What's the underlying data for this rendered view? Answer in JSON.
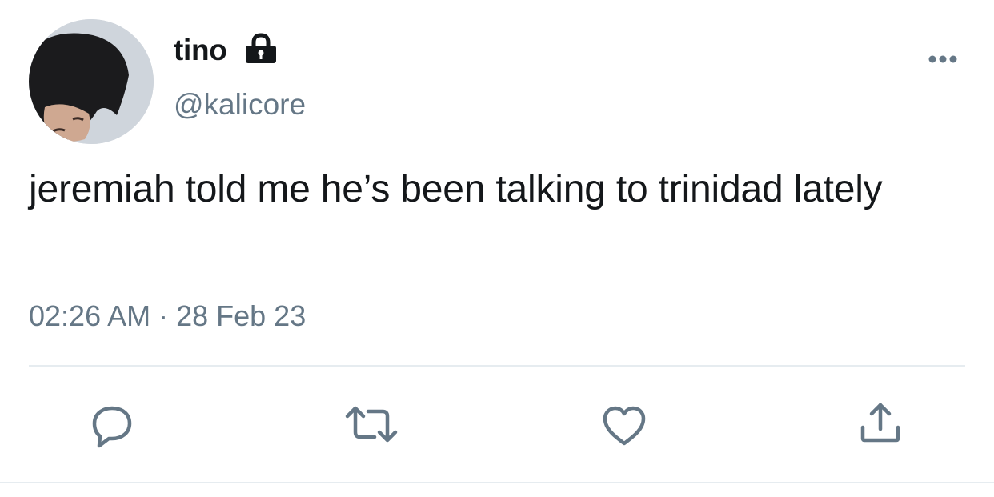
{
  "tweet": {
    "display_name": "tino",
    "handle": "@kalicore",
    "text": "jeremiah told me he’s been talking to trinidad lately",
    "timestamp": "02:26 AM · 28 Feb 23",
    "protected": true
  },
  "icons": {
    "lock": "lock-icon",
    "more": "more-options-icon",
    "reply": "reply-icon",
    "retweet": "retweet-icon",
    "like": "heart-icon",
    "share": "share-icon"
  },
  "colors": {
    "text_primary": "#14171a",
    "text_secondary": "#657786",
    "divider": "#e6ecf0"
  }
}
